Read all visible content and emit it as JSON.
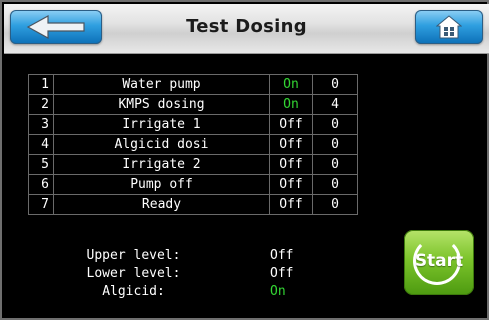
{
  "header": {
    "title": "Test Dosing",
    "back_icon": "arrow-left-icon",
    "home_icon": "home-icon"
  },
  "steps": [
    {
      "num": "1",
      "name": "Water pump",
      "state": "On",
      "value": "0"
    },
    {
      "num": "2",
      "name": "KMPS dosing",
      "state": "On",
      "value": "4"
    },
    {
      "num": "3",
      "name": "Irrigate 1",
      "state": "Off",
      "value": "0"
    },
    {
      "num": "4",
      "name": "Algicid dosi",
      "state": "Off",
      "value": "0"
    },
    {
      "num": "5",
      "name": "Irrigate 2",
      "state": "Off",
      "value": "0"
    },
    {
      "num": "6",
      "name": "Pump off",
      "state": "Off",
      "value": "0"
    },
    {
      "num": "7",
      "name": "Ready",
      "state": "Off",
      "value": "0"
    }
  ],
  "levels": [
    {
      "label": "Upper level:",
      "value": "Off"
    },
    {
      "label": "Lower level:",
      "value": "Off"
    },
    {
      "label": "Algicid:",
      "value": "On"
    }
  ],
  "start_button": {
    "label": "Start"
  },
  "colors": {
    "on": "#33d633",
    "off": "#ffffff",
    "accent": "#2f9fe0",
    "start": "#7cc42b"
  }
}
